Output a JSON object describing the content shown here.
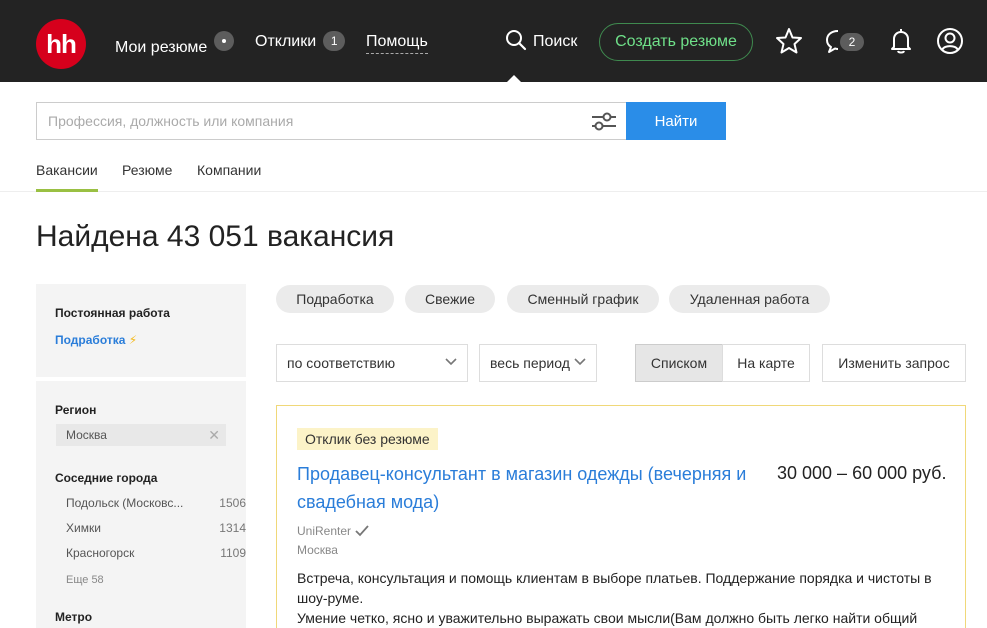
{
  "header": {
    "logo_text": "hh",
    "nav": {
      "my_resume": "Мои резюме",
      "responses": "Отклики",
      "responses_count": "1",
      "help": "Помощь"
    },
    "search_label": "Поиск",
    "create_resume": "Создать резюме",
    "chat_count": "2"
  },
  "search": {
    "placeholder": "Профессия, должность или компания",
    "value": "",
    "find_button": "Найти"
  },
  "tabs": [
    {
      "label": "Вакансии",
      "active": true
    },
    {
      "label": "Резюме",
      "active": false
    },
    {
      "label": "Компании",
      "active": false
    }
  ],
  "page_title": "Найдена 43 051 вакансия",
  "sidebar": {
    "employment_title": "Постоянная работа",
    "part_time_link": "Подработка",
    "part_time_bolt": "⚡",
    "region_title": "Регион",
    "region_value": "Москва",
    "neighbors_title": "Соседние города",
    "cities": [
      {
        "name": "Подольск (Московс...",
        "count": "1506"
      },
      {
        "name": "Химки",
        "count": "1314"
      },
      {
        "name": "Красногорск",
        "count": "1109"
      }
    ],
    "more": "Еще 58",
    "metro_title": "Метро"
  },
  "chips": [
    "Подработка",
    "Свежие",
    "Сменный график",
    "Удаленная работа"
  ],
  "controls": {
    "sort": "по соответствию",
    "period": "весь период",
    "view_list": "Списком",
    "view_map": "На карте",
    "change_query": "Изменить запрос"
  },
  "vacancy": {
    "badge": "Отклик без резюме",
    "title": "Продавец-консультант в магазин одежды (вечерняя и свадебная мода)",
    "salary": "30 000 – 60 000 руб.",
    "company": "UniRenter",
    "city": "Москва",
    "description_1": "Встреча, консультация и помощь клиентам в выборе платьев. Поддержание порядка и чистоты в шоу-руме.",
    "description_2": "Умение четко, ясно и уважительно выражать свои мысли(Вам должно быть легко найти общий"
  }
}
